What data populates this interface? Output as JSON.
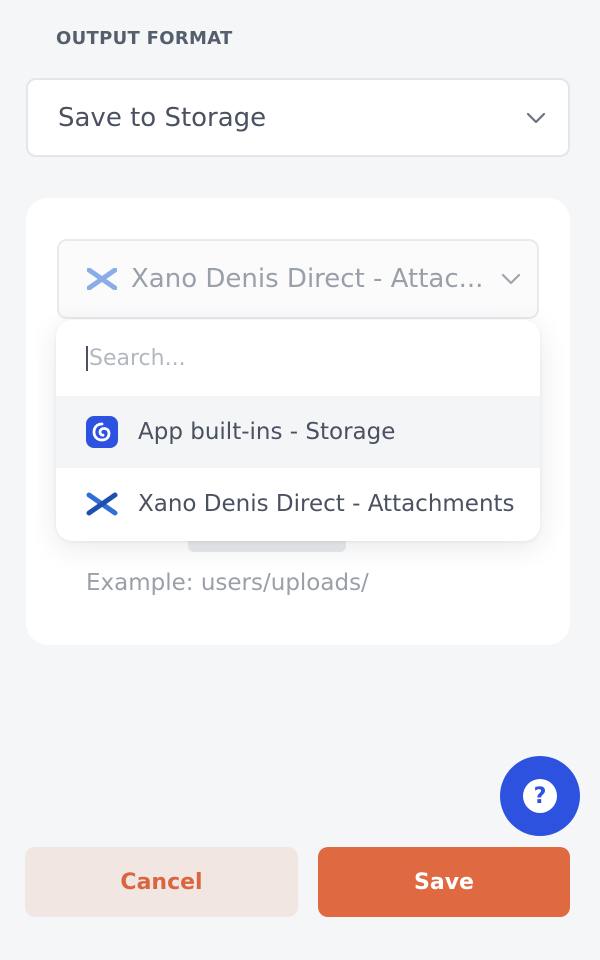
{
  "output_format": {
    "label": "OUTPUT FORMAT",
    "selected": "Save to Storage"
  },
  "storage": {
    "selected": "Xano Denis Direct - Attac...",
    "example_hint": "Example: users/uploads/"
  },
  "dropdown": {
    "search_placeholder": "Search...",
    "options": [
      {
        "label": "App built-ins - Storage",
        "icon": "app-builtins-icon",
        "highlighted": true
      },
      {
        "label": "Xano Denis Direct - Attachments",
        "icon": "xano-icon",
        "highlighted": false
      }
    ]
  },
  "help": {
    "glyph": "?"
  },
  "actions": {
    "cancel_label": "Cancel",
    "save_label": "Save"
  },
  "colors": {
    "accent_orange": "#df6941",
    "help_blue": "#2d52e0",
    "xano_blue": "#2f6fd6"
  }
}
